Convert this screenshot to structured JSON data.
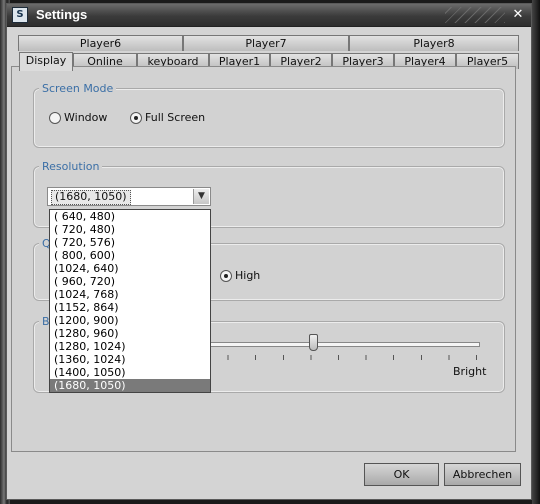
{
  "window": {
    "title": "Settings",
    "app_icon": "app-logo-icon",
    "close_glyph": "✕"
  },
  "tabs_row_back": [
    {
      "label": "Player6"
    },
    {
      "label": "Player7"
    },
    {
      "label": "Player8"
    }
  ],
  "tabs_row_front": [
    {
      "label": "Display",
      "active": true
    },
    {
      "label": "Online"
    },
    {
      "label": "keyboard"
    },
    {
      "label": "Player1"
    },
    {
      "label": "Player2"
    },
    {
      "label": "Player3"
    },
    {
      "label": "Player4"
    },
    {
      "label": "Player5"
    }
  ],
  "screen_mode": {
    "label": "Screen Mode",
    "options": [
      {
        "label": "Window",
        "selected": false
      },
      {
        "label": "Full Screen",
        "selected": true
      }
    ]
  },
  "resolution": {
    "label": "Resolution",
    "selected": "(1680, 1050)",
    "options": [
      "( 640, 480)",
      "( 720, 480)",
      "( 720, 576)",
      "( 800, 600)",
      "(1024, 640)",
      "( 960, 720)",
      "(1024, 768)",
      "(1152, 864)",
      "(1200, 900)",
      "(1280, 960)",
      "(1280, 1024)",
      "(1360, 1024)",
      "(1400, 1050)",
      "(1680, 1050)"
    ]
  },
  "quality": {
    "label_partial": "Q",
    "option_high": "High",
    "high_selected": true
  },
  "brightness": {
    "label_partial": "B",
    "max_label": "Bright",
    "value_fraction": 0.43
  },
  "buttons": {
    "ok": "OK",
    "cancel": "Abbrechen"
  }
}
